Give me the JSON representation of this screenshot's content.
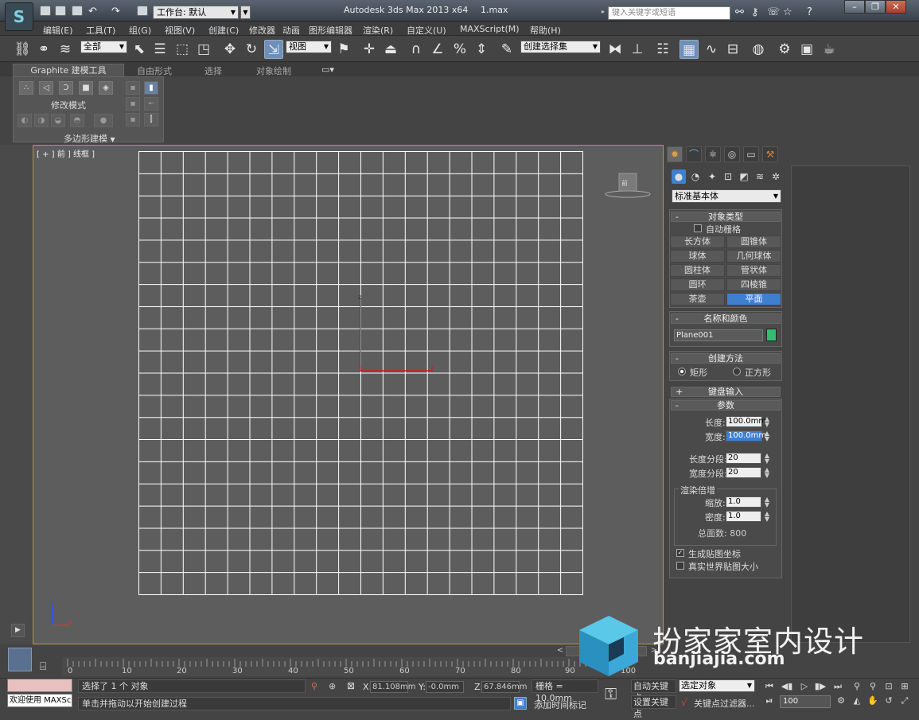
{
  "titlebar": {
    "app_title": "Autodesk 3ds Max  2013 x64",
    "filename": "1.max",
    "workspace_label": "工作台: 默认",
    "search_placeholder": "键入关键字或短语",
    "window_controls": [
      "minimize-icon",
      "restore-icon",
      "close-icon"
    ]
  },
  "menubar": {
    "items": [
      "编辑(E)",
      "工具(T)",
      "组(G)",
      "视图(V)",
      "创建(C)",
      "修改器",
      "动画",
      "图形编辑器",
      "渲染(R)",
      "自定义(U)",
      "MAXScript(M)",
      "帮助(H)"
    ]
  },
  "toolbar": {
    "selection_filter": "全部",
    "reference_coord": "视图",
    "named_selection": "创建选择集"
  },
  "ribbon": {
    "tabs": [
      "Graphite 建模工具",
      "自由形式",
      "选择",
      "对象绘制"
    ],
    "group_label": "修改模式",
    "panel_label": "多边形建模"
  },
  "viewport": {
    "label": "[ + ] 前 ] 线框 ]",
    "grid_rows": 20,
    "grid_cols": 20
  },
  "command_panel": {
    "category": "标准基本体",
    "object_type": {
      "header": "对象类型",
      "auto_grid": "自动栅格",
      "buttons": [
        "长方体",
        "圆锥体",
        "球体",
        "几何球体",
        "圆柱体",
        "管状体",
        "圆环",
        "四棱锥",
        "茶壶",
        "平面"
      ],
      "selected": "平面"
    },
    "name_color": {
      "header": "名称和颜色",
      "name": "Plane001",
      "color": "#2fbf6f"
    },
    "creation_method": {
      "header": "创建方法",
      "option_rect": "矩形",
      "option_square": "正方形"
    },
    "keyboard_entry": {
      "header": "键盘输入"
    },
    "parameters": {
      "header": "参数",
      "length_label": "长度:",
      "length": "100.0mm",
      "width_label": "宽度:",
      "width": "100.0mm",
      "length_segs_label": "长度分段:",
      "length_segs": "20",
      "width_segs_label": "宽度分段:",
      "width_segs": "20",
      "render_mult_label": "渲染倍增",
      "scale_label": "缩放:",
      "scale": "1.0",
      "density_label": "密度:",
      "density": "1.0",
      "total_faces": "总面数: 800",
      "gen_mapping": "生成贴图坐标",
      "real_world": "真实世界贴图大小"
    }
  },
  "timeline": {
    "slider": "0 / 100",
    "ticks": [
      "0",
      "10",
      "20",
      "30",
      "40",
      "50",
      "60",
      "70",
      "80",
      "90",
      "100"
    ]
  },
  "status": {
    "welcome": "欢迎使用 MAXSc",
    "selected_msg": "选择了 1 个 对象",
    "prompt_msg": "单击并拖动以开始创建过程",
    "x_label": "X:",
    "x": "81.108mm",
    "y_label": "Y:",
    "y": "-0.0mm",
    "z_label": "Z:",
    "z": "67.846mm",
    "grid": "栅格 = 10.0mm",
    "add_time_tag": "添加时间标记",
    "auto_key": "自动关键点",
    "set_key": "设置关键点",
    "key_mode": "选定对象",
    "key_filters": "关键点过滤器...",
    "frame": "100"
  },
  "watermark": {
    "text": "扮家家室内设计",
    "url": "banjiajia.com"
  }
}
